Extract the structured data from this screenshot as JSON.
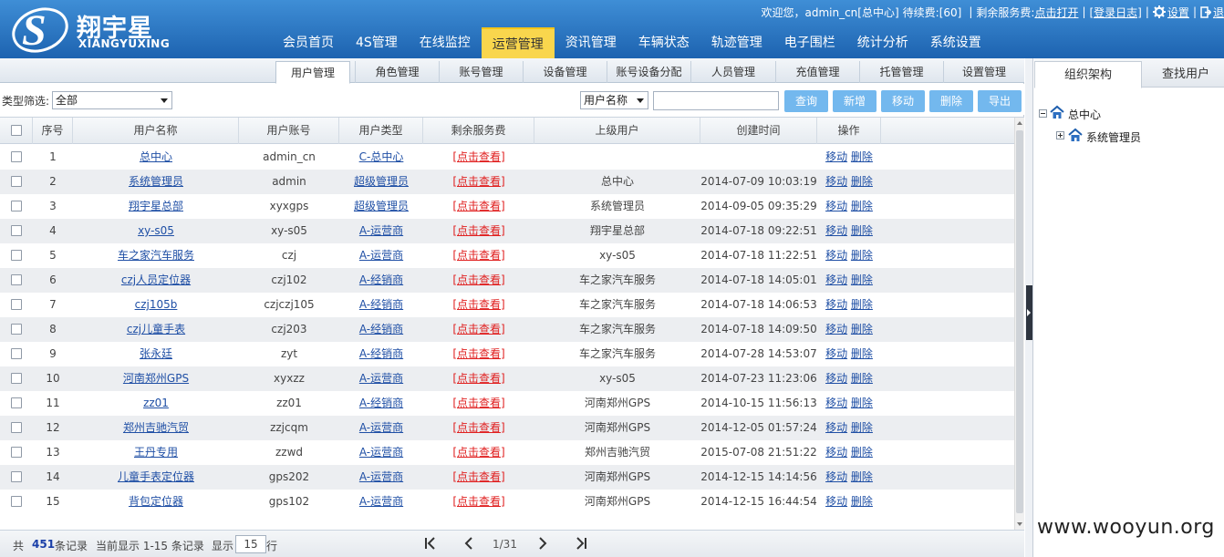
{
  "header": {
    "logo_title": "翔宇星",
    "logo_sub": "XIANGYUXING",
    "welcome": "欢迎您，admin_cn[总中心]",
    "pending_fee": "待续费:[60]",
    "remaining_label": "剩余服务费:",
    "remaining_link": "点击打开",
    "logout_link": "[登录日志]",
    "settings_link": "设置",
    "exit_link": "退",
    "nav": [
      "会员首页",
      "4S管理",
      "在线监控",
      "运营管理",
      "资讯管理",
      "车辆状态",
      "轨迹管理",
      "电子围栏",
      "统计分析",
      "系统设置"
    ],
    "active_nav": "运营管理"
  },
  "subtabs": [
    "用户管理",
    "角色管理",
    "账号管理",
    "设备管理",
    "账号设备分配",
    "人员管理",
    "充值管理",
    "托管管理",
    "设置管理"
  ],
  "toolbar": {
    "filter_label": "类型筛选:",
    "filter_value": "全部",
    "search_field": "用户名称",
    "search_value": "",
    "buttons": [
      "查询",
      "新增",
      "移动",
      "删除",
      "导出"
    ]
  },
  "table": {
    "headers": [
      "序号",
      "用户名称",
      "用户账号",
      "用户类型",
      "剩余服务费",
      "上级用户",
      "创建时间",
      "操作"
    ],
    "fee_link": "[点击查看]",
    "op_move": "移动",
    "op_delete": "删除",
    "rows": [
      {
        "no": "1",
        "name": "总中心",
        "account": "admin_cn",
        "type": "C-总中心",
        "parent": "",
        "created": ""
      },
      {
        "no": "2",
        "name": "系统管理员",
        "account": "admin",
        "type": "超级管理员",
        "parent": "总中心",
        "created": "2014-07-09 10:03:19"
      },
      {
        "no": "3",
        "name": "翔宇星总部",
        "account": "xyxgps",
        "type": "超级管理员",
        "parent": "系统管理员",
        "created": "2014-09-05 09:35:29"
      },
      {
        "no": "4",
        "name": "xy-s05",
        "account": "xy-s05",
        "type": "A-运营商",
        "parent": "翔宇星总部",
        "created": "2014-07-18 09:22:51"
      },
      {
        "no": "5",
        "name": "车之家汽车服务",
        "account": "czj",
        "type": "A-运营商",
        "parent": "xy-s05",
        "created": "2014-07-18 11:22:51"
      },
      {
        "no": "6",
        "name": "czj人员定位器",
        "account": "czj102",
        "type": "A-经销商",
        "parent": "车之家汽车服务",
        "created": "2014-07-18 14:05:01"
      },
      {
        "no": "7",
        "name": "czj105b",
        "account": "czjczj105",
        "type": "A-经销商",
        "parent": "车之家汽车服务",
        "created": "2014-07-18 14:06:53"
      },
      {
        "no": "8",
        "name": "czj儿童手表",
        "account": "czj203",
        "type": "A-经销商",
        "parent": "车之家汽车服务",
        "created": "2014-07-18 14:09:50"
      },
      {
        "no": "9",
        "name": "张永廷",
        "account": "zyt",
        "type": "A-经销商",
        "parent": "车之家汽车服务",
        "created": "2014-07-28 14:53:07"
      },
      {
        "no": "10",
        "name": "河南郑州GPS",
        "account": "xyxzz",
        "type": "A-运营商",
        "parent": "xy-s05",
        "created": "2014-07-23 11:23:06"
      },
      {
        "no": "11",
        "name": "zz01",
        "account": "zz01",
        "type": "A-经销商",
        "parent": "河南郑州GPS",
        "created": "2014-10-15 11:56:13"
      },
      {
        "no": "12",
        "name": "郑州吉驰汽贸",
        "account": "zzjcqm",
        "type": "A-运营商",
        "parent": "河南郑州GPS",
        "created": "2014-12-05 01:57:24"
      },
      {
        "no": "13",
        "name": "王丹专用",
        "account": "zzwd",
        "type": "A-运营商",
        "parent": "郑州吉驰汽贸",
        "created": "2015-07-08 21:51:22"
      },
      {
        "no": "14",
        "name": "儿童手表定位器",
        "account": "gps202",
        "type": "A-运营商",
        "parent": "河南郑州GPS",
        "created": "2014-12-15 14:14:56"
      },
      {
        "no": "15",
        "name": "背包定位器",
        "account": "gps102",
        "type": "A-运营商",
        "parent": "河南郑州GPS",
        "created": "2014-12-15 16:44:54"
      }
    ]
  },
  "footer": {
    "total_prefix": "共",
    "total": "451",
    "total_suffix": "条记录",
    "showing": "当前显示 1-15 条记录",
    "show_label": "显示",
    "page_size": "15",
    "rows_label": "行",
    "page_info": "1/31"
  },
  "right_panel": {
    "tabs": [
      "组织架构",
      "查找用户"
    ],
    "tree": [
      "总中心",
      "系统管理员"
    ]
  },
  "watermark": "www.wooyun.org",
  "colors": {
    "header": "#2a74c3",
    "active_nav": "#f9d64d",
    "button": "#73b8ee",
    "link": "#1f4fa5",
    "fee_link": "#e02020"
  }
}
